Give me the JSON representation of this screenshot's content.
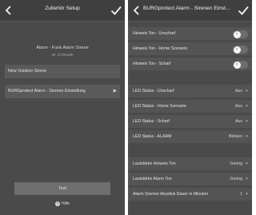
{
  "left": {
    "header": {
      "title": "Zubehör Setup"
    },
    "device": {
      "name": "Alarm - Funk Alarm Sirene",
      "id": "ID: IChl0swlh"
    },
    "items": [
      {
        "label": "New Outdoor Sirene"
      },
      {
        "label": "BURGprotect Alarm - Sirenen Einstellung"
      }
    ],
    "test_label": "Test",
    "help_label": "Hilfe"
  },
  "right": {
    "header": {
      "title": "BURGprotect Alarm - Sirenen Einst..."
    },
    "toggles": [
      {
        "label": "Hinweis Ton - Unscharf",
        "state": "off"
      },
      {
        "label": "Hinweis Ton - Home Szenario",
        "state": "off"
      },
      {
        "label": "Hinweis Ton - Scharf",
        "state": "off"
      }
    ],
    "led_rows": [
      {
        "label": "LED Status - Unscharf",
        "value": "Aus"
      },
      {
        "label": "LED Status - Home Szenario",
        "value": "Aus"
      },
      {
        "label": "LED Status - Scharf",
        "value": "Aus"
      },
      {
        "label": "LED Status - ALARM",
        "value": "Blinken"
      }
    ],
    "volume_rows": [
      {
        "label": "Lautstärke Hinweis Ton",
        "value": "Gering"
      },
      {
        "label": "Lautstärke Alarm Ton",
        "value": "Gering"
      },
      {
        "label": "Alarm Sirenen Akustisk Dauer in Minuten",
        "value": "1"
      }
    ]
  }
}
